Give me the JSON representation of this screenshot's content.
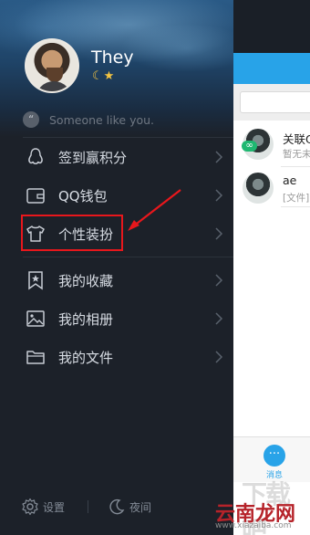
{
  "profile": {
    "name": "They",
    "level_icons": "moon-and-star-icons",
    "signature": "Someone like you.",
    "signature_icon": "quote-icon"
  },
  "menu": [
    {
      "label": "签到赢积分",
      "icon": "penguin-icon"
    },
    {
      "label": "QQ钱包",
      "icon": "wallet-icon"
    },
    {
      "label": "个性装扮",
      "icon": "tshirt-icon",
      "highlighted": true
    },
    {
      "label": "我的收藏",
      "icon": "bookmark-star-icon"
    },
    {
      "label": "我的相册",
      "icon": "photo-album-icon"
    },
    {
      "label": "我的文件",
      "icon": "folder-icon"
    }
  ],
  "bottom": {
    "settings_label": "设置",
    "night_label": "夜间"
  },
  "peek": {
    "conversations": [
      {
        "title": "关联Q",
        "subtitle": "暂无未"
      },
      {
        "title": "ae",
        "subtitle": "[文件]"
      }
    ],
    "tab_messages_label": "消息"
  },
  "watermark": {
    "brand_large": "下载吧",
    "brand": "云南龙网",
    "url": "www.xiazaiba.com"
  },
  "colors": {
    "accent": "#28a3e8",
    "highlight": "#e8171c",
    "drawer_bg": "#1c2129",
    "star": "#f5c542"
  }
}
